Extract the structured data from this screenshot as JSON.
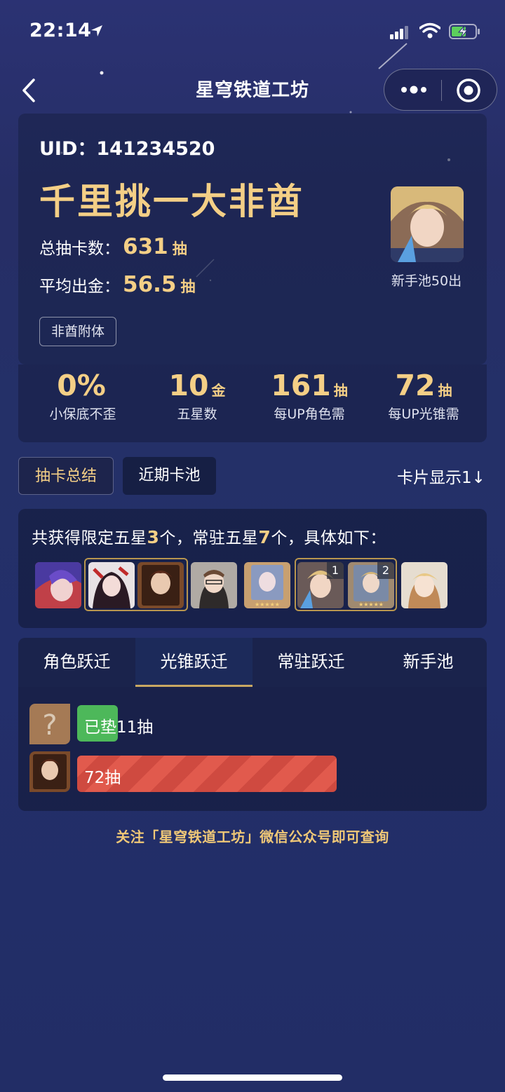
{
  "status_bar": {
    "time": "22:14"
  },
  "nav": {
    "title": "星穹铁道工坊"
  },
  "profile": {
    "uid": "UID：141234520",
    "rank_title": "千里挑一大非酋",
    "total_pulls_label": "总抽卡数：",
    "total_pulls_value": "631",
    "total_pulls_unit": "抽",
    "avg_gold_label": "平均出金：",
    "avg_gold_value": "56.5",
    "avg_gold_unit": "抽",
    "tag": "非酋附体",
    "avatar_caption": "新手池50出"
  },
  "stats": [
    {
      "value": "0%",
      "unit": "",
      "caption": "小保底不歪"
    },
    {
      "value": "10",
      "unit": "金",
      "caption": "五星数"
    },
    {
      "value": "161",
      "unit": "抽",
      "caption": "每UP角色需"
    },
    {
      "value": "72",
      "unit": "抽",
      "caption": "每UP光锥需"
    }
  ],
  "tabs": {
    "summary": "抽卡总结",
    "recent": "近期卡池",
    "card_display": "卡片显示1↓"
  },
  "summary": {
    "prefix": "共获得限定五星",
    "limited_count": "3",
    "mid": "个，常驻五星",
    "standard_count": "7",
    "suffix": "个，具体如下："
  },
  "group_badges": {
    "first": "1",
    "second": "2"
  },
  "pool_tabs": [
    "角色跃迁",
    "光锥跃迁",
    "常驻跃迁",
    "新手池"
  ],
  "pool_rows": {
    "pending_thumb": "?",
    "pending_text": "已垫11抽",
    "pending_fraction": 0.13,
    "last_text": "72抽",
    "last_fraction": 0.8
  },
  "footer": "关注「星穹铁道工坊」微信公众号即可查询",
  "colors": {
    "gold": "#f4cf86",
    "green": "#4db85a",
    "red": "#e15a4d",
    "frame": "#b8964f"
  }
}
